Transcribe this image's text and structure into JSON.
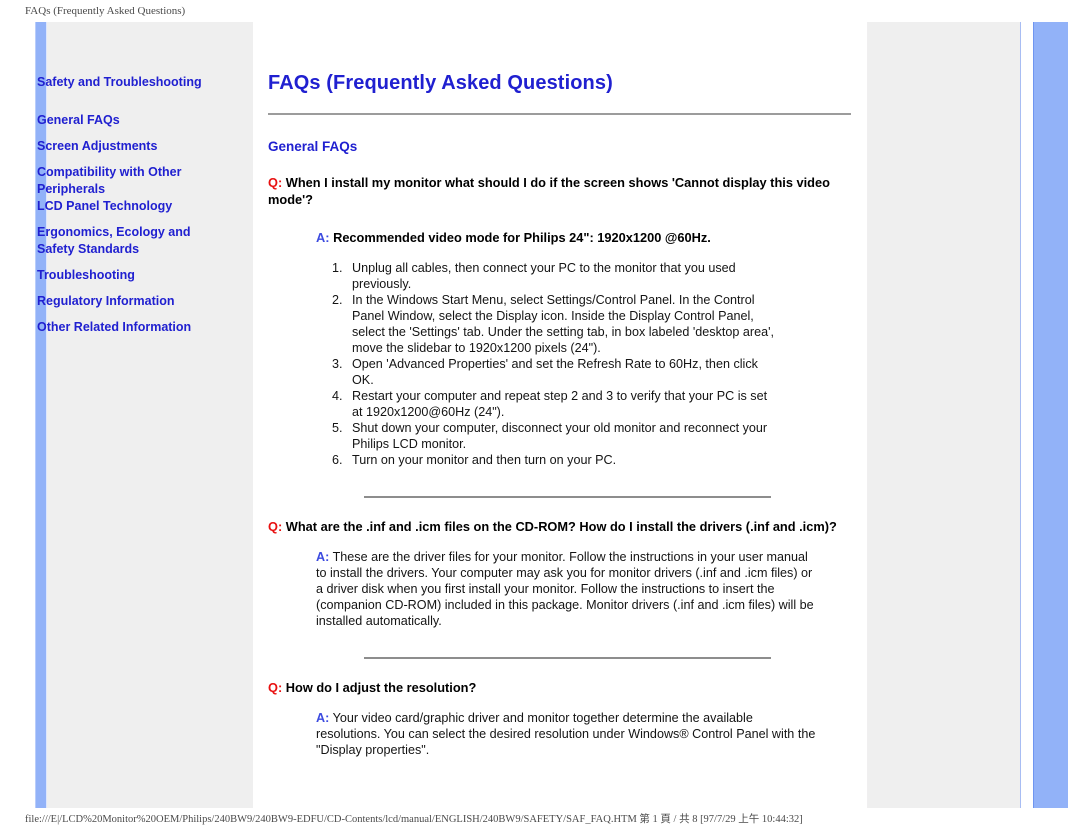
{
  "browser": {
    "header_title": "FAQs (Frequently Asked Questions)",
    "footer_text": "file:///E|/LCD%20Monitor%20OEM/Philips/240BW9/240BW9-EDFU/CD-Contents/lcd/manual/ENGLISH/240BW9/SAFETY/SAF_FAQ.HTM 第 1 頁 / 共 8 [97/7/29 上午 10:44:32]"
  },
  "sidebar": {
    "items": [
      {
        "label": "Safety and Troubleshooting"
      },
      {
        "label": "General FAQs"
      },
      {
        "label": "Screen Adjustments"
      },
      {
        "label": "Compatibility with Other Peripherals"
      },
      {
        "label": "LCD Panel Technology"
      },
      {
        "label": "Ergonomics, Ecology and Safety Standards"
      },
      {
        "label": "Troubleshooting"
      },
      {
        "label": "Regulatory Information"
      },
      {
        "label": "Other Related Information"
      }
    ]
  },
  "main": {
    "page_title": "FAQs (Frequently Asked Questions)",
    "section_title": "General FAQs",
    "q_marker": "Q:",
    "a_marker": "A:",
    "faqs": [
      {
        "question": "When I install my monitor what should I do if the screen shows 'Cannot display this video mode'?",
        "answer_head": "Recommended video mode for Philips 24\": 1920x1200 @60Hz.",
        "steps": [
          "Unplug all cables, then connect your PC to the monitor that you used previously.",
          "In the Windows Start Menu, select Settings/Control Panel. In the Control Panel Window, select the Display icon. Inside the Display Control Panel, select the 'Settings' tab. Under the setting tab, in box labeled 'desktop area', move the slidebar to 1920x1200 pixels (24\").",
          "Open 'Advanced Properties' and set the Refresh Rate to 60Hz, then click OK.",
          "Restart your computer and repeat step 2 and 3 to verify that your PC is set at 1920x1200@60Hz (24\").",
          "Shut down your computer, disconnect your old monitor and reconnect your Philips LCD monitor.",
          "Turn on your monitor and then turn on your PC."
        ]
      },
      {
        "question": "What are the .inf and .icm files on the CD-ROM? How do I install the drivers (.inf and .icm)?",
        "answer": "These are the driver files for your monitor. Follow the instructions in your user manual to install the drivers. Your computer may ask you for monitor drivers (.inf and .icm files) or a driver disk when you first install your monitor. Follow the instructions to insert the (companion CD-ROM) included in this package. Monitor drivers (.inf and .icm files) will be installed automatically."
      },
      {
        "question": "How do I adjust the resolution?",
        "answer": "Your video card/graphic driver and monitor together determine the available resolutions. You can select the desired resolution under Windows® Control Panel with the \"Display properties\"."
      }
    ]
  },
  "colors": {
    "link_blue": "#2020d0",
    "q_red": "#e81010",
    "a_blue": "#3c4be0",
    "panel_gray": "#efefef",
    "accent_bar": "#92b2f8"
  }
}
